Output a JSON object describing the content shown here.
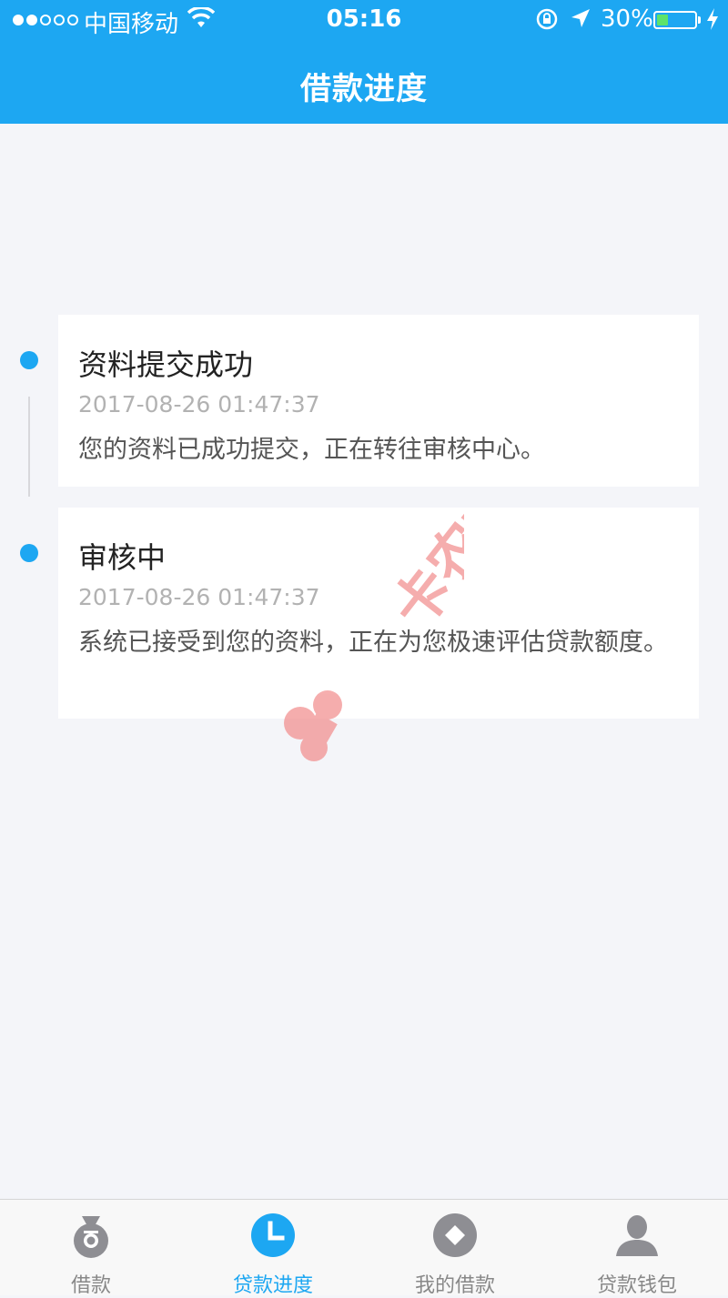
{
  "status_bar": {
    "carrier": "中国移动",
    "time": "05:16",
    "battery_percent": "30%",
    "battery_level": 0.3,
    "signal_bars": 2,
    "icons": [
      "signal-dots-icon",
      "wifi-icon",
      "rotation-lock-icon",
      "location-arrow-icon",
      "battery-icon",
      "charging-bolt-icon"
    ]
  },
  "header": {
    "title": "借款进度"
  },
  "timeline": [
    {
      "title": "资料提交成功",
      "time": "2017-08-26 01:47:37",
      "description": "您的资料已成功提交，正在转往审核中心。"
    },
    {
      "title": "审核中",
      "time": "2017-08-26 01:47:37",
      "description": "系统已接受到您的资料，正在为您极速评估贷款额度。"
    }
  ],
  "watermark": {
    "text": "卡农社区"
  },
  "tabbar": {
    "tabs": [
      {
        "label": "借款",
        "icon": "money-bag-icon",
        "active": false
      },
      {
        "label": "贷款进度",
        "icon": "clock-icon",
        "active": true
      },
      {
        "label": "我的借款",
        "icon": "diamond-icon",
        "active": false
      },
      {
        "label": "贷款钱包",
        "icon": "person-icon",
        "active": false
      }
    ]
  },
  "colors": {
    "accent": "#1da7f2",
    "background": "#f4f5f9",
    "inactive_tab": "#888888"
  }
}
